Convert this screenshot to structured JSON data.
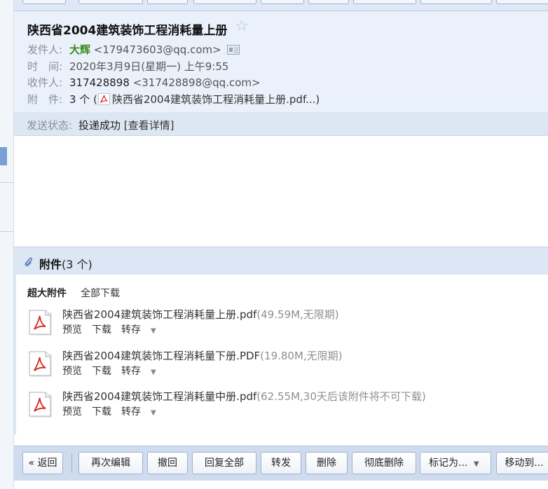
{
  "header": {
    "subject": "陕西省2004建筑装饰工程消耗量上册",
    "star_icon": "☆",
    "sender_label": "发件人:",
    "sender_name": "大辉",
    "sender_email": "<179473603@qq.com>",
    "time_label": "时　间:",
    "time_value": "2020年3月9日(星期一) 上午9:55",
    "recipient_label": "收件人:",
    "recipient_name": "317428898",
    "recipient_email": "<317428898@qq.com>",
    "attach_label": "附　件:",
    "attach_count": "3 个",
    "attach_first": "陕西省2004建筑装饰工程消耗量上册.pdf...)"
  },
  "status": {
    "label": "发送状态:",
    "value": "投递成功",
    "detail_link": "[查看详情]"
  },
  "attachments": {
    "title": "附件",
    "count": "(3 个)",
    "big_label": "超大附件",
    "download_all": "全部下载",
    "files": [
      {
        "name": "陕西省2004建筑装饰工程消耗量上册.pdf",
        "meta": "(49.59M,无限期)",
        "preview": "预览",
        "download": "下载",
        "transfer": "转存"
      },
      {
        "name": "陕西省2004建筑装饰工程消耗量下册.PDF",
        "meta": "(19.80M,无限期)",
        "preview": "预览",
        "download": "下载",
        "transfer": "转存"
      },
      {
        "name": "陕西省2004建筑装饰工程消耗量中册.pdf",
        "meta": "(62.55M,30天后该附件将不可下载)",
        "preview": "预览",
        "download": "下载",
        "transfer": "转存"
      }
    ]
  },
  "toolbar": {
    "back": "« 返回",
    "reedit": "再次编辑",
    "recall": "撤回",
    "reply_all": "回复全部",
    "forward": "转发",
    "delete": "删除",
    "delete_permanent": "彻底删除",
    "mark_as": "标记为...",
    "move_to": "移动到..."
  },
  "colors": {
    "header_bg": "#eaf1fb",
    "sender_green": "#3a8a1e",
    "toolbar_bg": "#cfdbee",
    "pdf_red": "#d9261c"
  }
}
